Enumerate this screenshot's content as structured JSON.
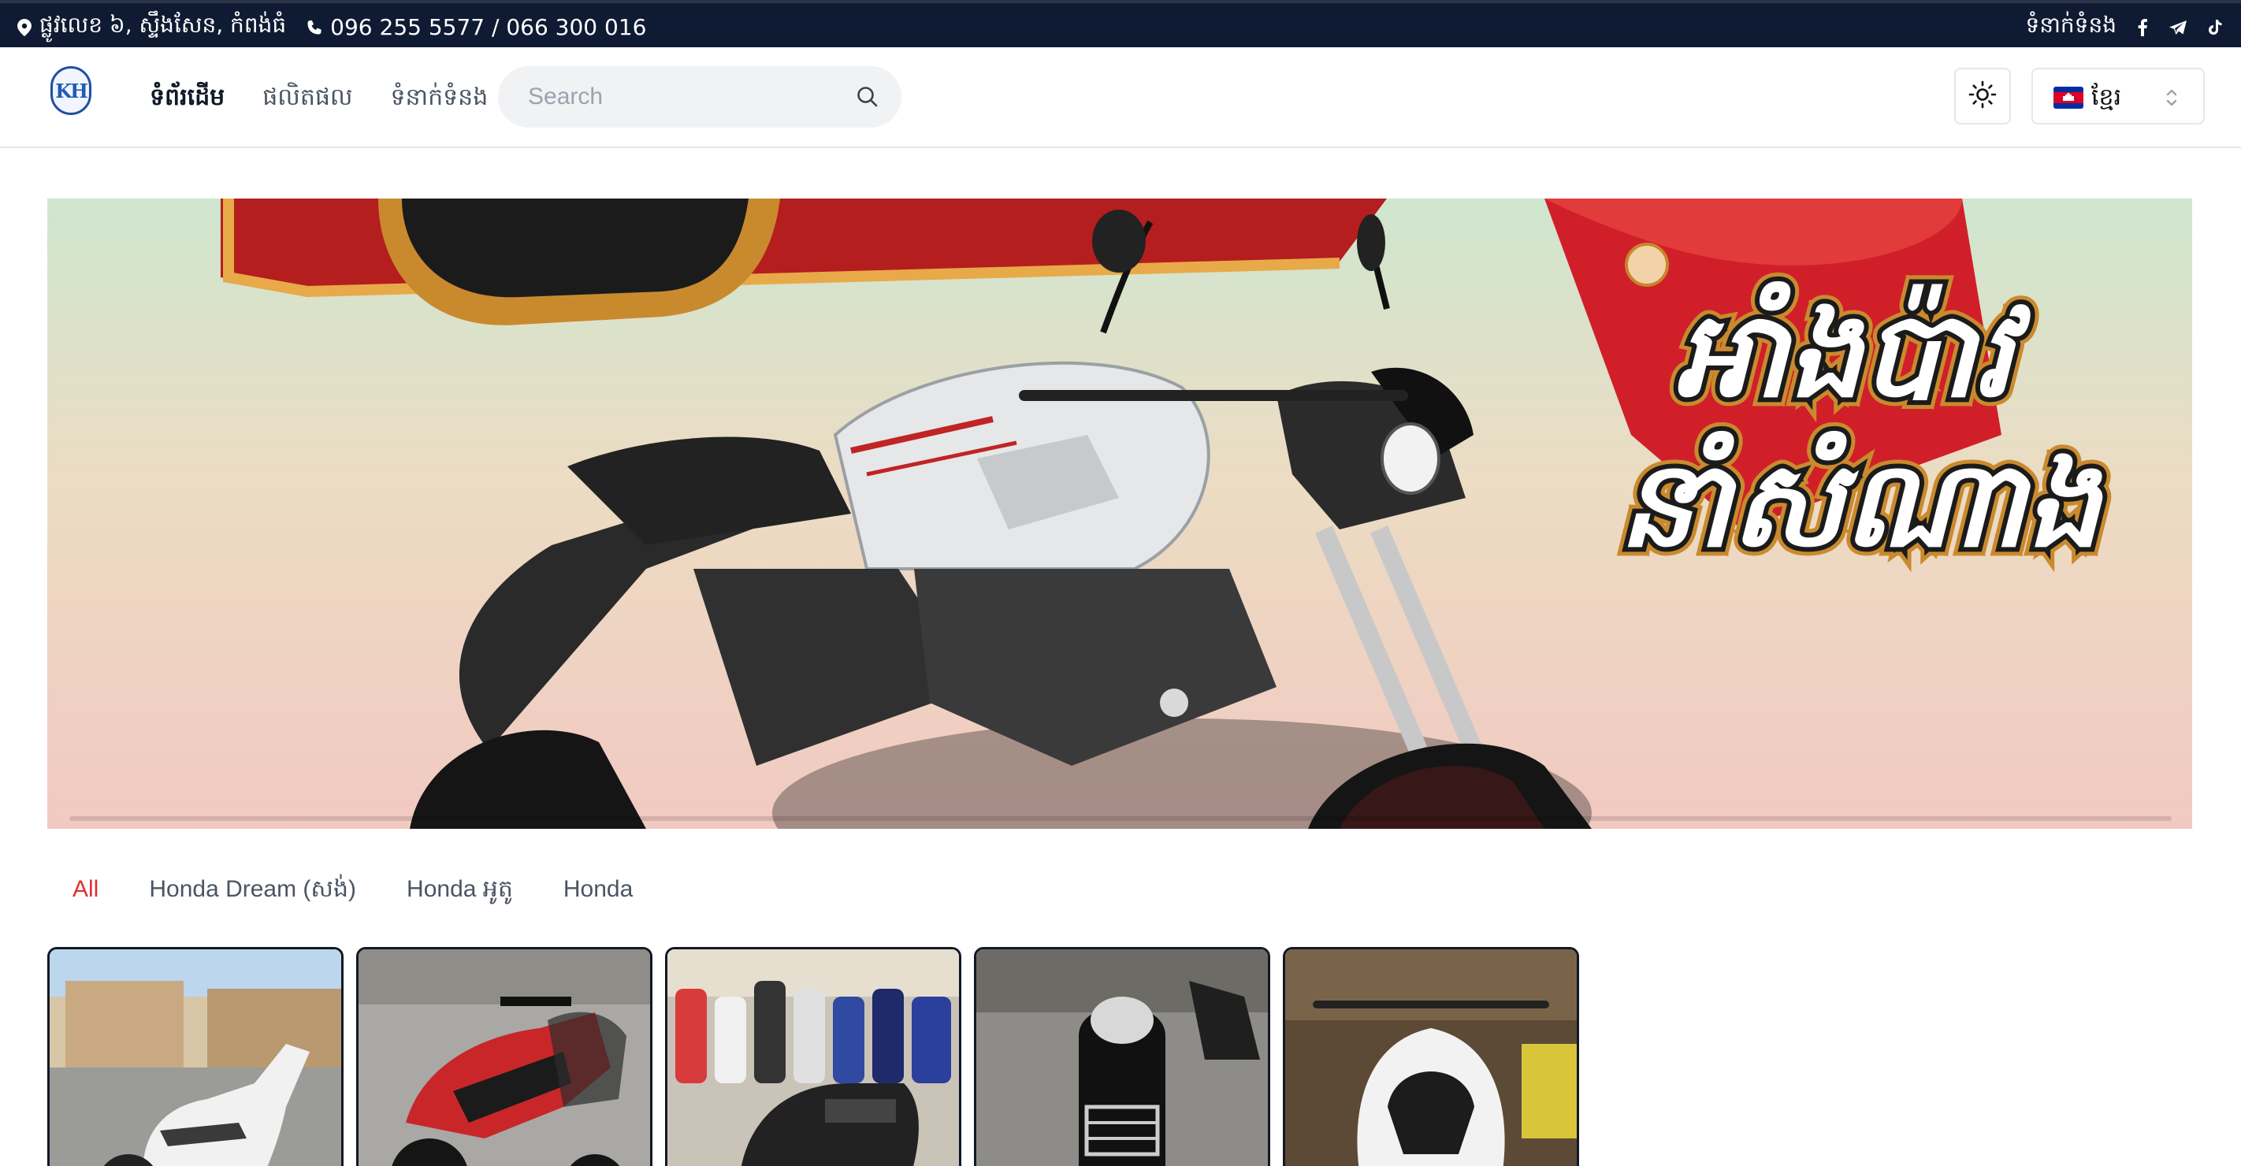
{
  "topbar": {
    "address": "ផ្លូវលេខ ៦, ស្ទឹងសែន, កំពង់ធំ",
    "phone": "096 255 5577 / 066 300 016",
    "contact_label": "ទំនាក់ទំនង",
    "social_icons": [
      "facebook-icon",
      "telegram-icon",
      "tiktok-icon"
    ]
  },
  "header": {
    "logo_text": "KH",
    "nav": [
      {
        "label": "ទំព័រដើម",
        "active": true
      },
      {
        "label": "ផលិតផល",
        "active": false
      },
      {
        "label": "ទំនាក់ទំនង",
        "active": false
      }
    ],
    "search": {
      "placeholder": "Search",
      "value": ""
    },
    "language": {
      "label": "ខ្មែរ"
    }
  },
  "banner": {
    "headline_line1": "អាំងប៉ាវ",
    "headline_line2": "នាំសំណាង"
  },
  "tabs": [
    {
      "label": "All",
      "active": true
    },
    {
      "label": "Honda Dream (សង់)",
      "active": false
    },
    {
      "label": "Honda អូតូ",
      "active": false
    },
    {
      "label": "Honda",
      "active": false
    }
  ],
  "colors": {
    "topbar_bg": "#0f1b33",
    "accent_red": "#e03131",
    "card_border": "#111827"
  },
  "products": [
    {
      "image": "white-scooter-photo"
    },
    {
      "image": "red-black-scooter-photo"
    },
    {
      "image": "showroom-motorbikes-photo"
    },
    {
      "image": "black-honda-dream-photo"
    },
    {
      "image": "white-pcx-scooter-photo"
    }
  ]
}
